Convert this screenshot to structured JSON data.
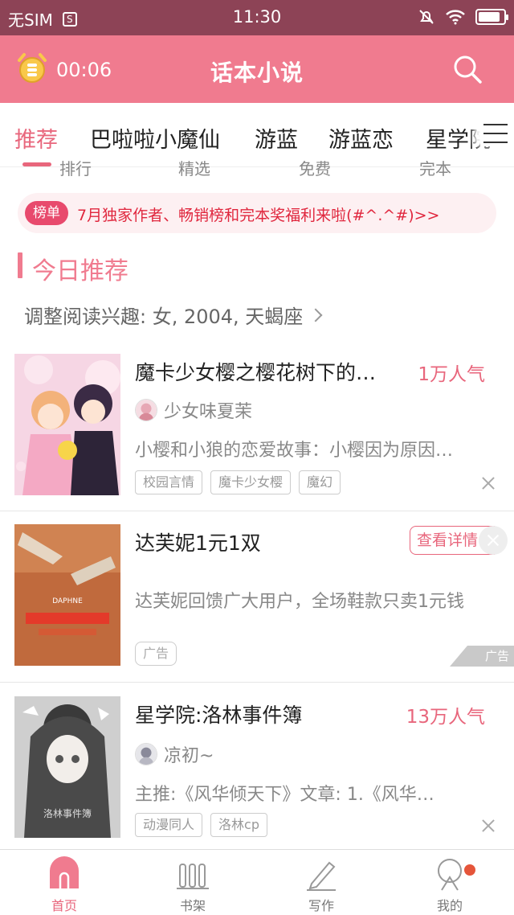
{
  "status_bar": {
    "carrier": "无SIM",
    "sim_icon": "S",
    "time": "11:30",
    "battery_level": 0.85
  },
  "header": {
    "timer": "00:06",
    "title": "话本小说"
  },
  "tabs": [
    {
      "label": "推荐",
      "active": true
    },
    {
      "label": "巴啦啦小魔仙"
    },
    {
      "label": "游蓝"
    },
    {
      "label": "游蓝恋"
    },
    {
      "label": "星学院"
    }
  ],
  "cut_labels": [
    "排行",
    "精选",
    "免费",
    "完本"
  ],
  "notice": {
    "badge": "榜单",
    "text": "7月独家作者、畅销榜和完本奖福利来啦(#^.^#)>>"
  },
  "section": {
    "title": "今日推荐",
    "interest": "调整阅读兴趣: 女, 2004, 天蝎座"
  },
  "books": [
    {
      "title": "魔卡少女樱之樱花树下的…",
      "popularity": "1万人气",
      "author": "少女味夏茉",
      "desc": "小樱和小狼的恋爱故事：小樱因为原因…",
      "tags": [
        "校园言情",
        "魔卡少女樱",
        "魔幻"
      ]
    },
    {
      "title": "星学院:洛林事件簿",
      "popularity": "13万人气",
      "author": "凉初~",
      "desc": "主推:《风华倾天下》文章:  1.《风华…",
      "tags": [
        "动漫同人",
        "洛林cp"
      ]
    }
  ],
  "ad": {
    "title": "达芙妮1元1双",
    "button": "查看详情",
    "desc": "达芙妮回馈广大用户，全场鞋款只卖1元钱",
    "tag": "广告",
    "corner": "广告"
  },
  "bottom_nav": [
    {
      "label": "首页",
      "icon": "home-icon",
      "active": true
    },
    {
      "label": "书架",
      "icon": "bookshelf-icon"
    },
    {
      "label": "写作",
      "icon": "pen-icon"
    },
    {
      "label": "我的",
      "icon": "profile-icon",
      "badge": true
    }
  ],
  "colors": {
    "status_bar": "#8d4356",
    "header": "#f07b8f",
    "accent": "#e8667c",
    "notice_bg": "#fdf0f2"
  }
}
